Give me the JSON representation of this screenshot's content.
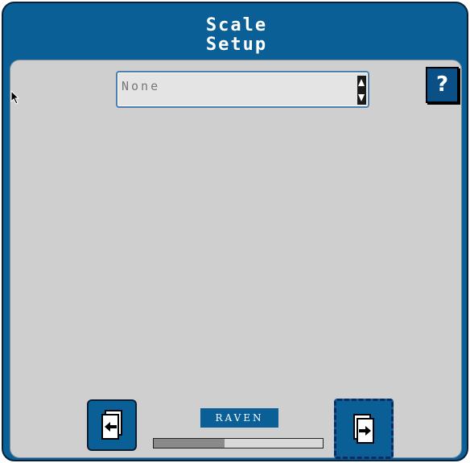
{
  "window": {
    "title_line1": "Scale",
    "title_line2": "Setup"
  },
  "scale_select": {
    "value": "None",
    "icon": "up-down-spinner-icon"
  },
  "help": {
    "label": "?"
  },
  "navigation": {
    "back_icon": "page-back-arrow-icon",
    "next_icon": "page-next-arrow-icon"
  },
  "brand": {
    "logo_text": "RAVEN"
  },
  "progress": {
    "fraction": 0.42
  },
  "colors": {
    "frame": "#0a5f97",
    "panel": "#cfcfcf",
    "focus_dash": "#0a2a66"
  }
}
